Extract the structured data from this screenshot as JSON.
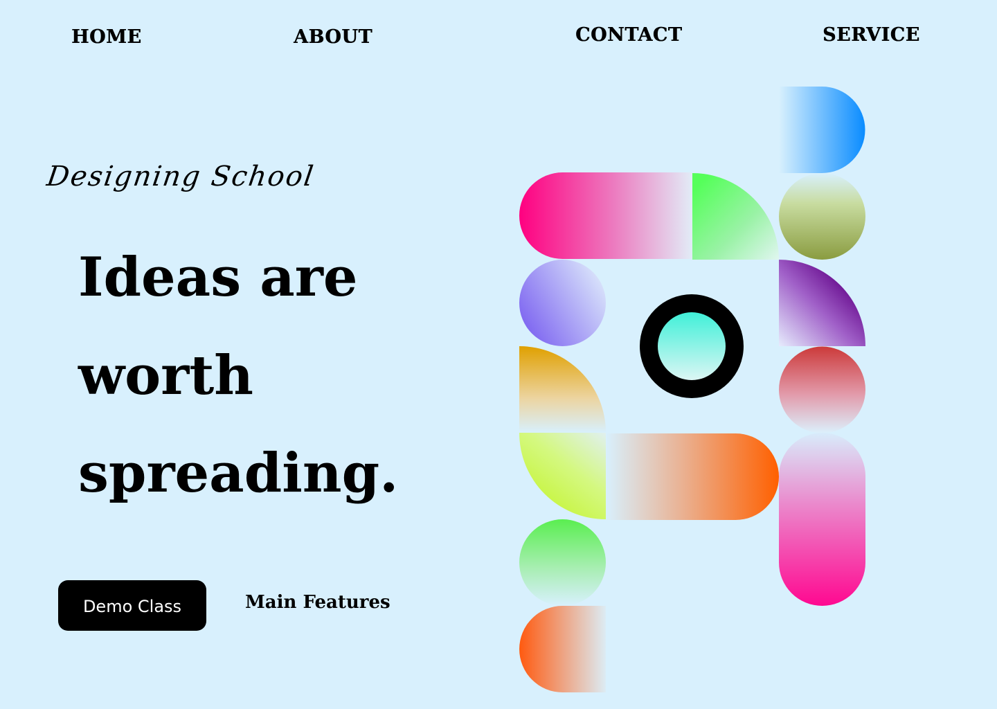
{
  "nav": {
    "home": "HOME",
    "about": "ABOUT",
    "contact": "CONTACT",
    "service": "SERVICE"
  },
  "brand": "Designing School",
  "hero": {
    "line1": "Ideas are",
    "line2": "worth",
    "line3": "spreading."
  },
  "actions": {
    "demo_button": "Demo Class",
    "features_link": "Main Features"
  },
  "colors": {
    "background": "#d8f0fd",
    "button_background": "#000000",
    "button_text": "#ffffff",
    "pink": "#ff0080",
    "blue": "#0a90ff",
    "green": "#55ff55",
    "purple": "#6a1090",
    "teal": "#40f0d8",
    "orange": "#ff6000"
  }
}
